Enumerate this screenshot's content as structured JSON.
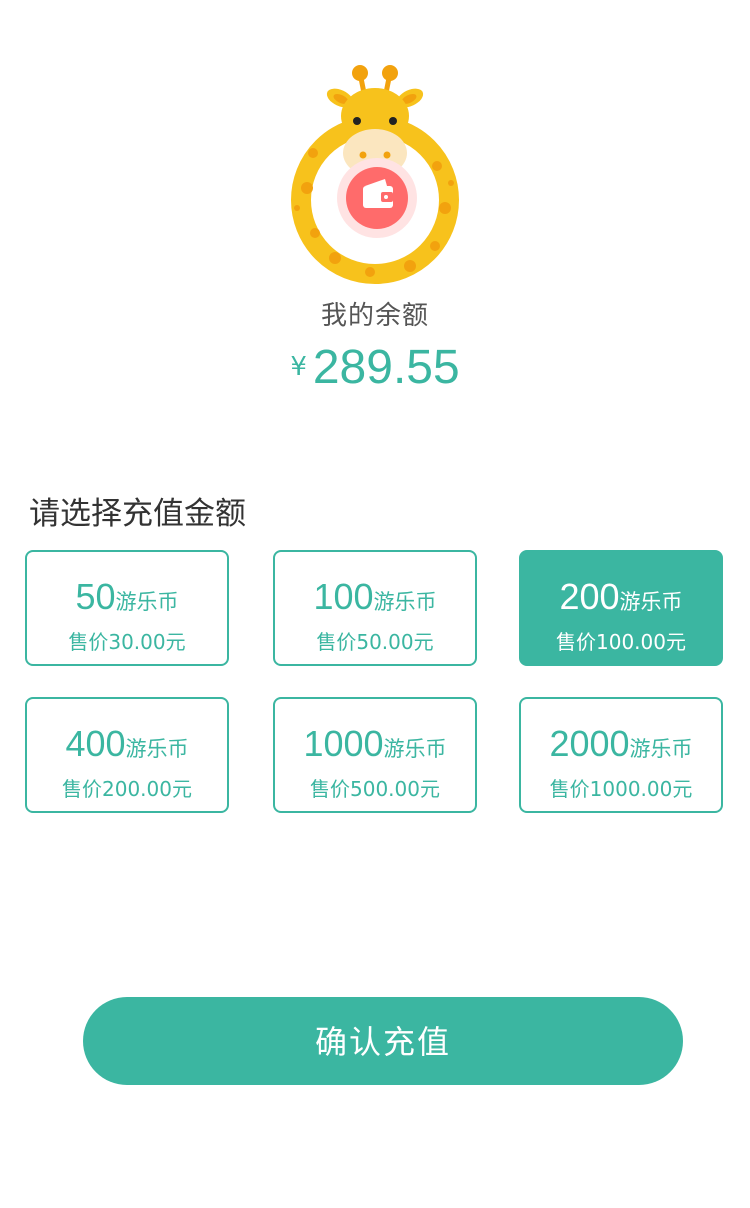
{
  "balance": {
    "label": "我的余额",
    "currency_symbol": "¥",
    "amount": "289.55"
  },
  "section_title": "请选择充值金额",
  "options": [
    {
      "amount": "50",
      "unit": "游乐币",
      "price": "售价30.00元",
      "selected": false
    },
    {
      "amount": "100",
      "unit": "游乐币",
      "price": "售价50.00元",
      "selected": false
    },
    {
      "amount": "200",
      "unit": "游乐币",
      "price": "售价100.00元",
      "selected": true
    },
    {
      "amount": "400",
      "unit": "游乐币",
      "price": "售价200.00元",
      "selected": false
    },
    {
      "amount": "1000",
      "unit": "游乐币",
      "price": "售价500.00元",
      "selected": false
    },
    {
      "amount": "2000",
      "unit": "游乐币",
      "price": "售价1000.00元",
      "selected": false
    }
  ],
  "confirm_button": {
    "label": "确认充值"
  },
  "colors": {
    "accent": "#3bb6a1",
    "mascot_yellow": "#f7c21c",
    "wallet_red": "#ff6b6b"
  },
  "icons": {
    "mascot": "giraffe-mascot-icon",
    "wallet": "wallet-icon"
  }
}
